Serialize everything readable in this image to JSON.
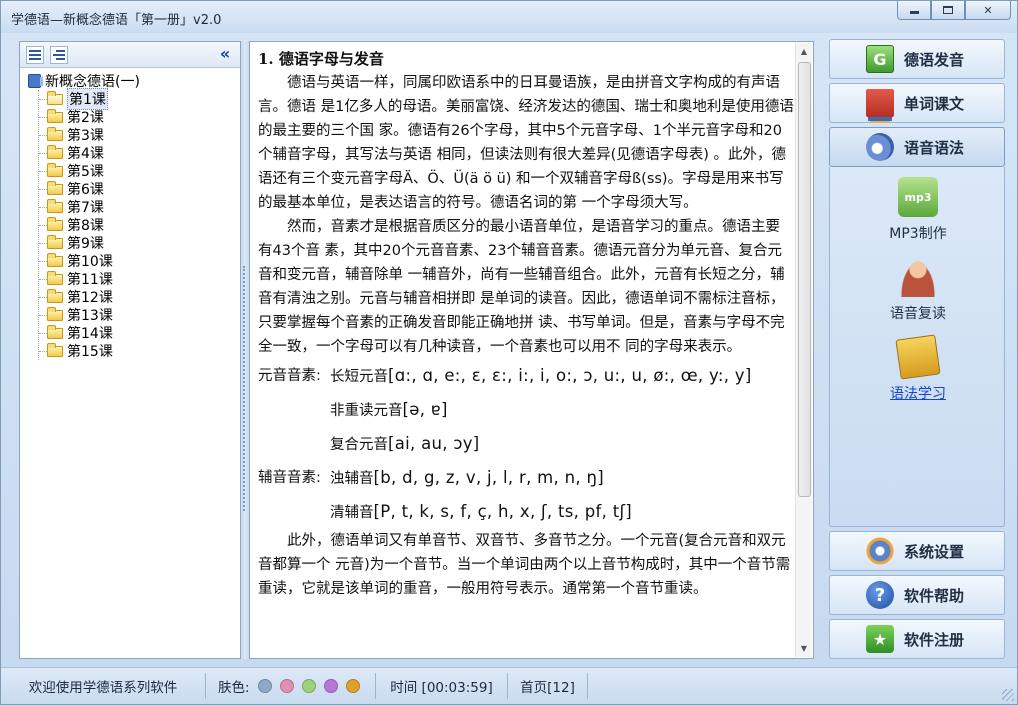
{
  "window": {
    "title": "学德语—新概念德语「第一册」v2.0"
  },
  "tree": {
    "root_label": "新概念德语(一)",
    "items": [
      {
        "label": "第1课",
        "selected": true
      },
      {
        "label": "第2课"
      },
      {
        "label": "第3课"
      },
      {
        "label": "第4课"
      },
      {
        "label": "第5课"
      },
      {
        "label": "第6课"
      },
      {
        "label": "第7课"
      },
      {
        "label": "第8课"
      },
      {
        "label": "第9课"
      },
      {
        "label": "第10课"
      },
      {
        "label": "第11课"
      },
      {
        "label": "第12课"
      },
      {
        "label": "第13课"
      },
      {
        "label": "第14课"
      },
      {
        "label": "第15课"
      }
    ]
  },
  "content": {
    "heading": "1. 德语字母与发音",
    "para1": "德语与英语一样，同属印欧语系中的日耳曼语族，是由拼音文字构成的有声语言。德语 是1亿多人的母语。美丽富饶、经济发达的德国、瑞士和奥地利是使用德语的最主要的三个国 家。德语有26个字母，其中5个元音字母、1个半元音字母和20个辅音字母，其写法与英语 相同，但读法则有很大差异(见德语字母表) 。此外，德语还有三个变元音字母Ä、Ö、Ü(ä ö ü) 和一个双辅音字母ß(ss)。字母是用来书写的最基本单位，是表达语言的符号。德语名词的第 一个字母须大写。",
    "para2": "然而，音素才是根据音质区分的最小语音单位，是语音学习的重点。德语主要有43个音 素，其中20个元音音素、23个辅音音素。德语元音分为单元音、复合元音和变元音，辅音除单 一辅音外，尚有一些辅音组合。此外，元音有长短之分，辅音有清浊之别。元音与辅音相拼即 是单词的读音。因此，德语单词不需标注音标，只要掌握每个音素的正确发音即能正确地拼 读、书写单词。但是，音素与字母不完全一致，一个字母可以有几种读音，一个音素也可以用不 同的字母来表示。",
    "vowel_label": "元音音素:",
    "vowel_long_short": "长短元音",
    "vowel_long_short_symbols": "[ɑ:, ɑ, e:, ɛ, ɛ:, i:, i, o:, ɔ, u:, u, ø:, œ, y:, y]",
    "vowel_unstressed": "非重读元音",
    "vowel_unstressed_symbols": "[ə, ɐ]",
    "vowel_compound": "复合元音",
    "vowel_compound_symbols": "[ai, au, ɔy]",
    "consonant_label": "辅音音素:",
    "consonant_voiced": "浊辅音",
    "consonant_voiced_symbols": "[b, d, g, z, v, j, l, r, m, n, ŋ]",
    "consonant_voiceless": "清辅音",
    "consonant_voiceless_symbols": "[P, t, k, s, f, ç, h, x, ʃ, ts, pf, tʃ]",
    "para3": "此外，德语单词又有单音节、双音节、多音节之分。一个元音(复合元音和双元音都算一个 元音)为一个音节。当一个单词由两个以上音节构成时，其中一个音节需重读，它就是该单词的重音，一般用符号表示。通常第一个音节重读。"
  },
  "nav": {
    "pronunciation": "德语发音",
    "vocab_text": "单词课文",
    "phonetics_grammar": "语音语法",
    "sub_mp3": "MP3制作",
    "sub_repeat": "语音复读",
    "sub_grammar": "语法学习",
    "settings": "系统设置",
    "help": "软件帮助",
    "register": "软件注册"
  },
  "status": {
    "welcome": "欢迎使用学德语系列软件",
    "skin_label": "肤色:",
    "skin_colors": [
      "#8fa9c9",
      "#e28fb6",
      "#9ed27a",
      "#b777d8",
      "#e0a12a"
    ],
    "time": "时间 [00:03:59]",
    "page": "首页[12]"
  }
}
